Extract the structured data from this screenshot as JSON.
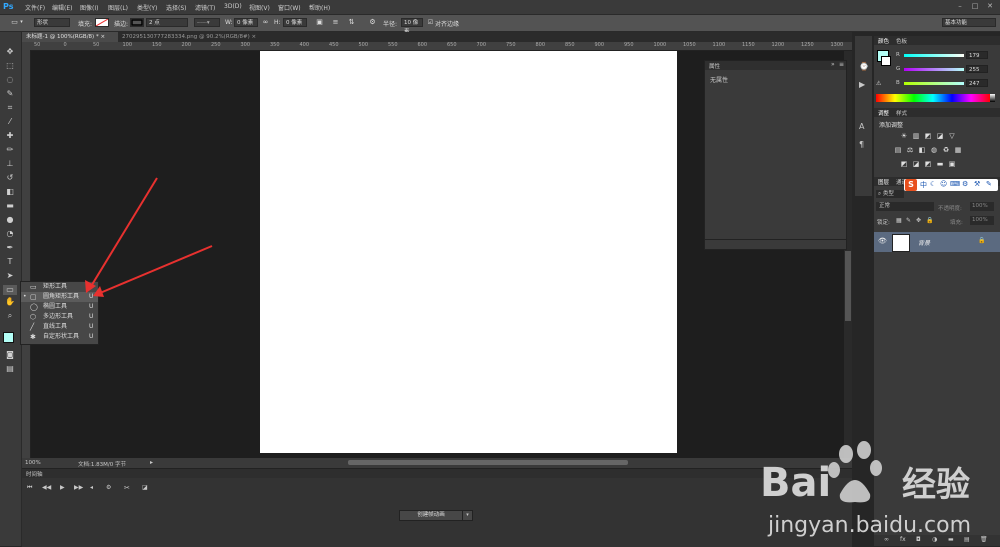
{
  "app": {
    "logo": "Ps"
  },
  "menu": [
    "文件(F)",
    "编辑(E)",
    "图像(I)",
    "图层(L)",
    "类型(Y)",
    "选择(S)",
    "滤镜(T)",
    "3D(D)",
    "视图(V)",
    "窗口(W)",
    "帮助(H)"
  ],
  "window_controls": [
    "–",
    "□",
    "✕"
  ],
  "options": {
    "mode": "形状",
    "fill_label": "填充:",
    "stroke_label": "描边:",
    "stroke_width": "2 点",
    "w_label": "W:",
    "w_value": "0 像素",
    "h_label": "H:",
    "h_value": "0 像素",
    "radius_label": "半径:",
    "radius_value": "10 像素",
    "align_edges": "对齐边缘",
    "workspace": "基本功能"
  },
  "tabs": [
    {
      "label": "未标题-1 @ 100%(RGB/8) *",
      "close": "×",
      "active": true
    },
    {
      "label": "270295130777283334.png @ 90.2%(RGB/8#)",
      "close": "×",
      "active": false
    }
  ],
  "ruler_numbers": [
    "50",
    "0",
    "50",
    "100",
    "150",
    "200",
    "250",
    "300",
    "350",
    "400",
    "450",
    "500",
    "550",
    "600",
    "650",
    "700",
    "750",
    "800",
    "850",
    "900",
    "950",
    "1000",
    "1050",
    "1100",
    "1150",
    "1200",
    "1250",
    "1300"
  ],
  "properties_panel": {
    "title": "属性",
    "body": "无属性"
  },
  "flyout": {
    "items": [
      {
        "label": "矩形工具",
        "shortcut": "U",
        "icon": "rectangle-icon",
        "selected": false
      },
      {
        "label": "圆角矩形工具",
        "shortcut": "U",
        "icon": "rounded-rectangle-icon",
        "selected": true
      },
      {
        "label": "椭圆工具",
        "shortcut": "U",
        "icon": "ellipse-icon",
        "selected": false
      },
      {
        "label": "多边形工具",
        "shortcut": "U",
        "icon": "polygon-icon",
        "selected": false
      },
      {
        "label": "直线工具",
        "shortcut": "U",
        "icon": "line-icon",
        "selected": false
      },
      {
        "label": "自定形状工具",
        "shortcut": "U",
        "icon": "custom-shape-icon",
        "selected": false
      }
    ]
  },
  "status": {
    "zoom": "100%",
    "doc": "文档:1.83M/0 字节"
  },
  "timeline": {
    "title": "时间轴",
    "create_button": "创建帧动画"
  },
  "color_panel": {
    "tabs": [
      "颜色",
      "色板"
    ],
    "channels": [
      {
        "label": "R",
        "value": "179"
      },
      {
        "label": "G",
        "value": "255"
      },
      {
        "label": "B",
        "value": "247"
      }
    ],
    "fg_color": "#b3fff7"
  },
  "adjust_panel": {
    "tabs": [
      "调整",
      "样式"
    ],
    "title": "添加调整"
  },
  "layers_panel": {
    "tabs": [
      "图层",
      "通道"
    ],
    "filter_kind": "类型",
    "blend_mode": "正常",
    "opacity_label": "不透明度:",
    "opacity_value": "100%",
    "lock_label": "锁定:",
    "fill_label": "填充:",
    "fill_value": "100%",
    "layer_name": "背景"
  },
  "watermark": {
    "brand": "Bai",
    "brand2": "经验",
    "url": "jingyan.baidu.com"
  },
  "colors": {
    "accent": "#31a8ff",
    "arrow": "#e8312f"
  }
}
